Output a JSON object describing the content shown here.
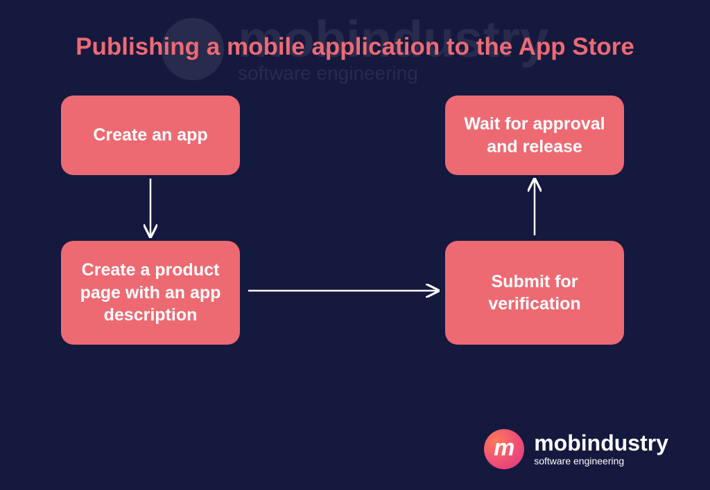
{
  "title": "Publishing a mobile application to the App Store",
  "steps": {
    "s1": "Create an app",
    "s2": "Create a product page with an app description",
    "s3": "Submit for verification",
    "s4": "Wait for approval and release"
  },
  "brand": {
    "name": "mobindustry",
    "tagline": "software engineering",
    "glyph": "m"
  },
  "colors": {
    "bg": "#15193e",
    "accent": "#ee6a73",
    "arrow": "#ffffff"
  }
}
